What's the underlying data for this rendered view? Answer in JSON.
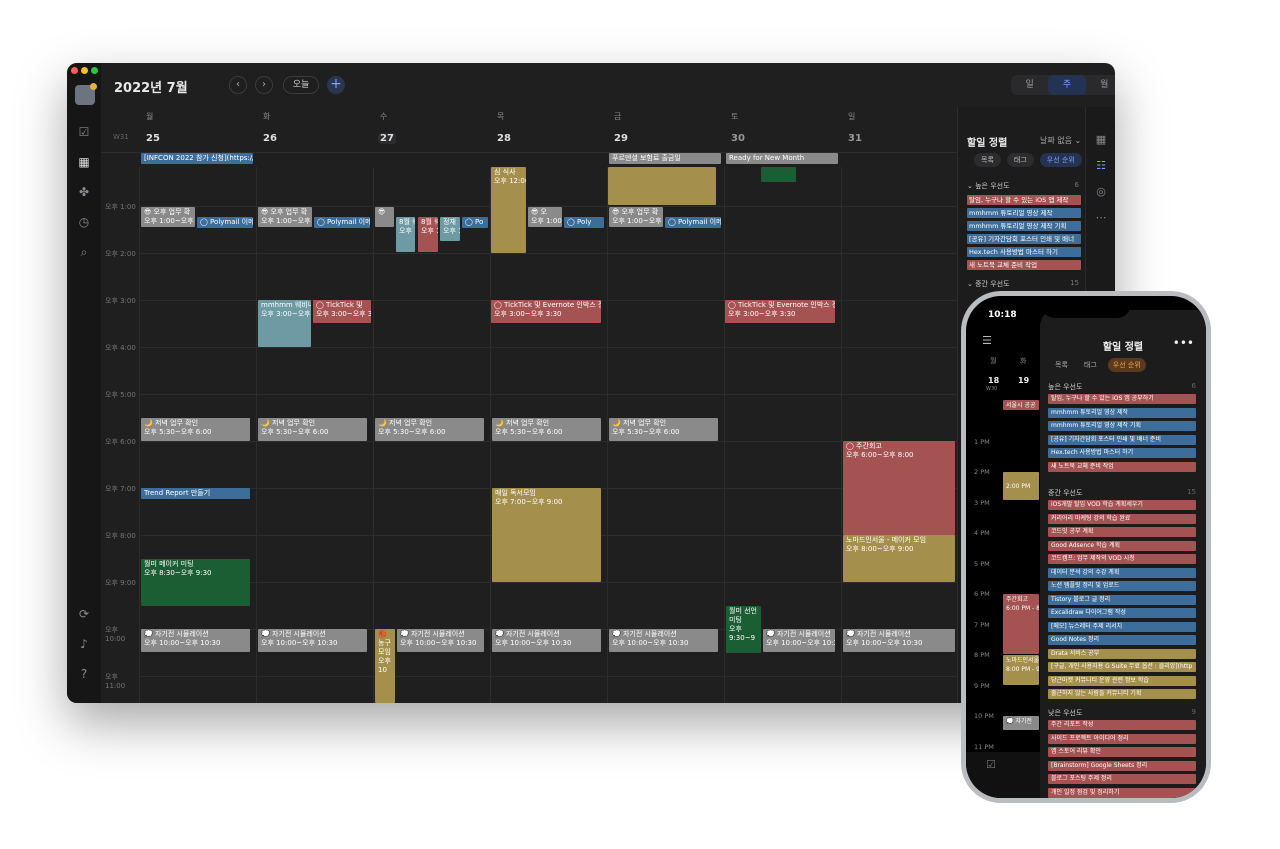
{
  "window": {
    "month_title": "2022년 7월",
    "today_label": "오늘",
    "prev_icon": "chevron-left-icon",
    "next_icon": "chevron-right-icon",
    "add_label": "+",
    "view_modes": [
      "일",
      "주",
      "월"
    ],
    "active_view": "주",
    "week_label": "W31",
    "day_names": [
      "월",
      "화",
      "수",
      "목",
      "금",
      "토",
      "일"
    ],
    "dates": [
      "25",
      "26",
      "27",
      "28",
      "29",
      "30",
      "31"
    ],
    "time_labels": [
      "오후 1:00",
      "오후 2:00",
      "오후 3:00",
      "오후 4:00",
      "오후 5:00",
      "오후 6:00",
      "오후 7:00",
      "오후 8:00",
      "오후 9:00",
      "오후 10:00",
      "오후 11:00"
    ],
    "allday": {
      "mon": "[INFCON 2022 참가 신청](https://i",
      "fri": "푸르덴셜 보험료 출금일",
      "sat": "Ready for New Month"
    },
    "events": {
      "work_title": "😎 오후 업무 확",
      "work_time": "오후 1:00~오후 1:3",
      "polymail": "◯ Polymail 이메",
      "polymail_short": "◯ Po",
      "work_wed": "😎",
      "wed_a_title": "8월 웨비",
      "wed_a_time": "오후 1",
      "wed_b_title": "8월 웨비",
      "wed_b_time": "오후 1",
      "wed_c_title": "정재",
      "wed_c_time": "오후 1",
      "thu_top_title": "심 식사",
      "thu_top_time": "오후 12:00",
      "thu_work": "😎 오",
      "thu_work_time": "오후 1:00",
      "thu_poly": "◯ Poly",
      "mmhmm_title": "mmhmm 웨비나",
      "mmhmm_time": "오후 3:00~오후 4:0",
      "ticktick_tue": "◯ TickTick 및",
      "ticktick_tue_time": "오후 3:00~오후 3",
      "ticktick_title": "◯ TickTick 및 Evernote 인박스 정리",
      "ticktick_time": "오후 3:00~오후 3:30",
      "evening_title": "🌙 저녁 업무 확인",
      "evening_time": "오후 5:30~오후 6:00",
      "weekly_title": "◯ 주간회고",
      "weekly_time": "오후 6:00~오후 8:00",
      "trend": "Trend Report 만들기",
      "reading_title": "매일 독서모임",
      "reading_time": "오후 7:00~오후 9:00",
      "nomad_title": "노마드인서울 - 메이커 모임",
      "nomad_time": "오후 8:00~오후 9:00",
      "maker_title": "월미 메이커 미팅",
      "maker_time": "오후 8:30~오후 9:30",
      "sat_meet_title": "월미 선언 미팅",
      "sat_meet_time": "오후 9:30~9",
      "sim_title": "💭 자기전 시뮬레이션",
      "sim_time": "오후 10:00~오후 10:30",
      "bball_title": "🏀 농구 모임",
      "bball_time": "오후 10"
    }
  },
  "sidebar": {
    "title": "할일 정렬",
    "date_filter": "날짜 없음 ⌄",
    "chips": [
      "목록",
      "태그",
      "우선 순위"
    ],
    "active_chip": "우선 순위",
    "high_label": "높은 우선도",
    "high_count": "6",
    "mid_label": "중간 우선도",
    "mid_count": "15",
    "items": [
      {
        "text": "탈임, 누구나 할 수 있는 iOS 앱 제작",
        "color": "#a55252"
      },
      {
        "text": "mmhmm 튜토리얼 영상 제작",
        "color": "#3d6e9b"
      },
      {
        "text": "mmhmm 튜토리얼 영상 제작 기획",
        "color": "#3d6e9b"
      },
      {
        "text": "[공유] 기자간담회 포스터 인쇄 및 배너",
        "color": "#3d6e9b"
      },
      {
        "text": "Hex.tech 사용방법 마스터 하기",
        "color": "#3d6e9b"
      },
      {
        "text": "새 노트북 교체 준비 작업",
        "color": "#a55252"
      }
    ]
  },
  "phone": {
    "time": "10:18",
    "status": "▂▄▆ ⌔ ▭",
    "title": "할일 정렬",
    "more": "•••",
    "day_names": [
      "월",
      "화"
    ],
    "dates": [
      "18",
      "19"
    ],
    "week": "W30",
    "chips": [
      "목록",
      "태그",
      "우선 순위"
    ],
    "active_chip": "우선 순위",
    "times": [
      "1 PM",
      "2 PM",
      "3 PM",
      "4 PM",
      "5 PM",
      "6 PM",
      "7 PM",
      "8 PM",
      "9 PM",
      "10 PM",
      "11 PM"
    ],
    "cal_events": {
      "seoul": "서울시 공공",
      "ev_2pm": "2:00 PM",
      "weekly": "주간회고",
      "weekly_time": "6:00 PM - 8",
      "nomad": "노마드인서울",
      "nomad_time": "8:00 PM - 9",
      "sim": "💭 자기전"
    },
    "high_label": "높은 우선도",
    "high_count": "6",
    "mid_label": "중간 우선도",
    "mid_count": "15",
    "low_label": "낮은 우선도",
    "low_count": "9",
    "high_items": [
      {
        "text": "탈임, 누구나 할 수 있는 iOS 앱 공부하기",
        "color": "#a55252"
      },
      {
        "text": "mmhmm 튜토리얼 영상 제작",
        "color": "#3d6e9b"
      },
      {
        "text": "mmhmm 튜토리얼 영상 제작 기획",
        "color": "#3d6e9b"
      },
      {
        "text": "[공유] 기자간담회 포스터 인쇄 및 배너 준비",
        "color": "#3d6e9b"
      },
      {
        "text": "Hex.tech 사용방법 마스터 하기",
        "color": "#3d6e9b"
      },
      {
        "text": "새 노트북 교체 준비 작업",
        "color": "#a55252"
      }
    ],
    "mid_items": [
      {
        "text": "iOS개발 탈임 VOD 학습 계획세우기",
        "color": "#a55252"
      },
      {
        "text": "커리어리 마케팅 강의 학습 완료",
        "color": "#a55252"
      },
      {
        "text": "코드잇 공부 계획",
        "color": "#a55252"
      },
      {
        "text": "Good Adsence 학습 계획",
        "color": "#a55252"
      },
      {
        "text": "코드캠프: 업무 제작의 VOD 시청",
        "color": "#a55252"
      },
      {
        "text": "데이터 분석 강의 수강 계획",
        "color": "#3d6e9b"
      },
      {
        "text": "노션 템플릿 정리 및 업로드",
        "color": "#3d6e9b"
      },
      {
        "text": "Tistory 블로그 글 정리",
        "color": "#3d6e9b"
      },
      {
        "text": "Excalidraw 다이어그램 작성",
        "color": "#3d6e9b"
      },
      {
        "text": "[메모] 뉴스레터 주제 리서치",
        "color": "#3d6e9b"
      },
      {
        "text": "Good Notes 정리",
        "color": "#3d6e9b"
      },
      {
        "text": "Drata 서비스 공부",
        "color": "#a58f4c"
      },
      {
        "text": "[구글, 개인 사용자용 G Suite 무료 옵션 : 클리앙](http",
        "color": "#a58f4c"
      },
      {
        "text": "당근마켓 커뮤니티 운영 관련 정보 학습",
        "color": "#a58f4c"
      },
      {
        "text": "줄근하지 않는 사람들 커뮤니티 기획",
        "color": "#a58f4c"
      }
    ],
    "low_items": [
      {
        "text": "주간 리포트 작성",
        "color": "#a55252"
      },
      {
        "text": "사이드 프로젝트 아이디어 정리",
        "color": "#a55252"
      },
      {
        "text": "앱 스토어 리뷰 확인",
        "color": "#a55252"
      },
      {
        "text": "[Brainstorm] Google Sheets 정리",
        "color": "#a55252"
      },
      {
        "text": "블로그 포스팅 주제 정리",
        "color": "#a55252"
      },
      {
        "text": "개인 일정 점검 및 정리하기",
        "color": "#a55252"
      }
    ]
  },
  "colors": {
    "accent_blue": "#7aa2ff",
    "accent_orange": "#e8a34b",
    "event_gray": "#8a8a8a",
    "event_blue": "#3d6e9b",
    "event_red": "#a55252",
    "event_gold": "#a58f4c",
    "event_green": "#1c5e33"
  }
}
